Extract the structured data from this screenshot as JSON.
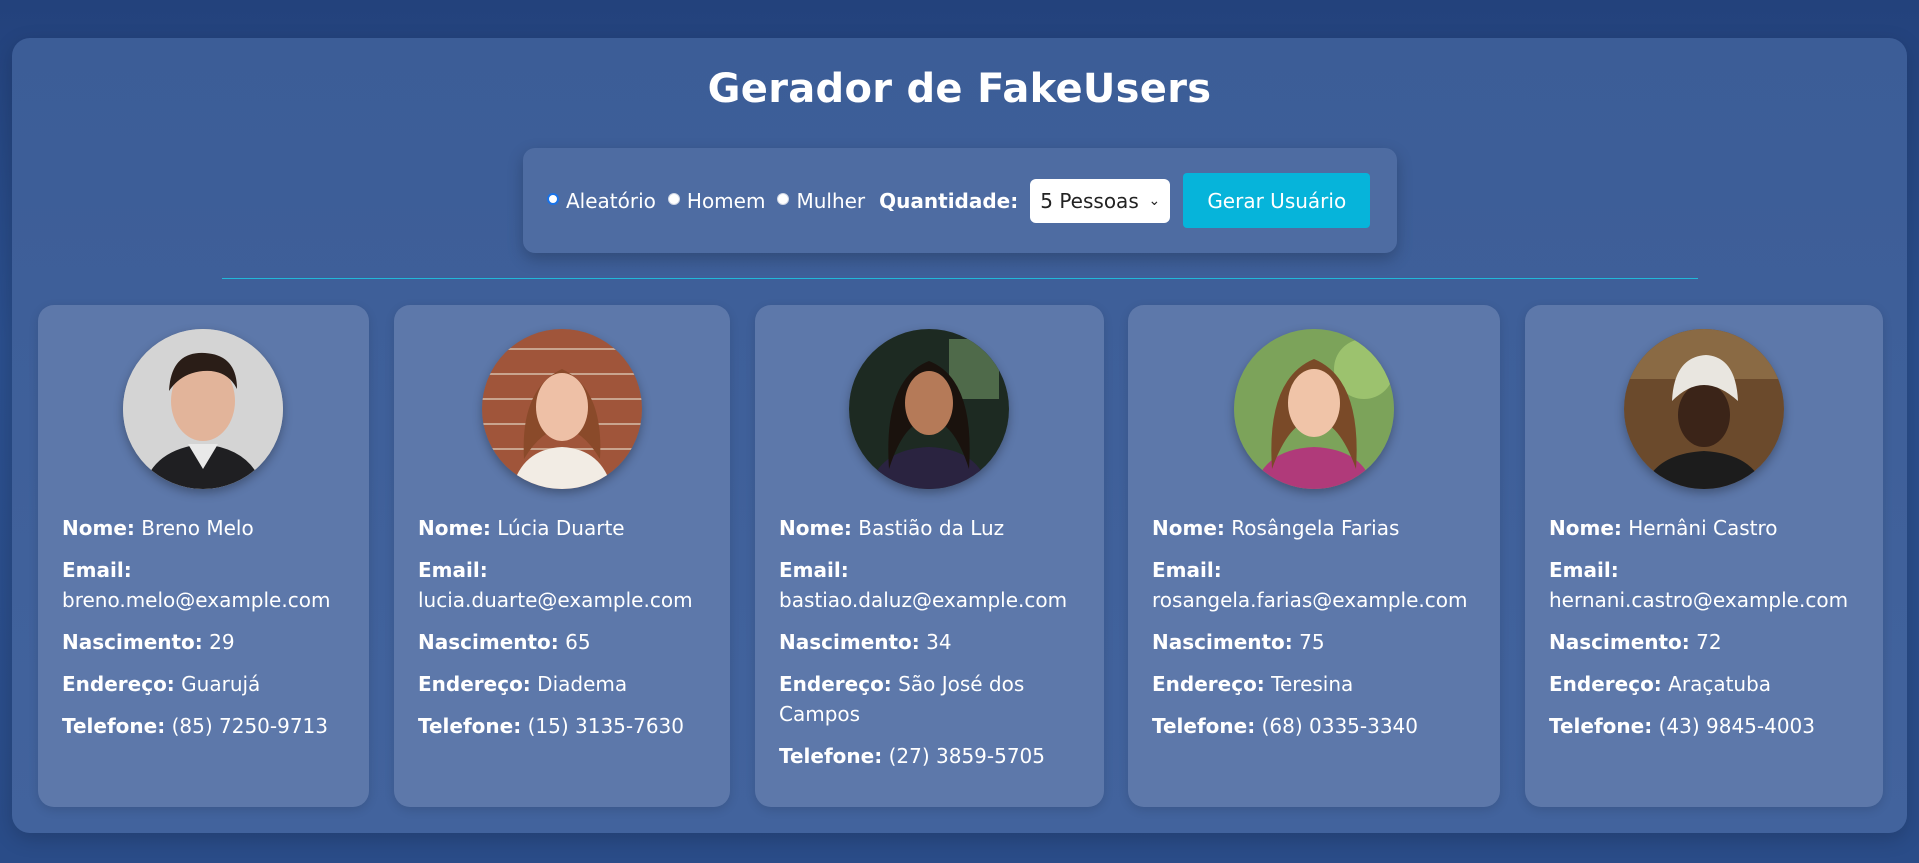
{
  "title": "Gerador de FakeUsers",
  "controls": {
    "options": [
      "Aleatório",
      "Homem",
      "Mulher"
    ],
    "selected_option": "Aleatório",
    "quantity_label": "Quantidade:",
    "quantity_value": "5 Pessoas",
    "button_label": "Gerar Usuário"
  },
  "field_labels": {
    "name": "Nome:",
    "email": "Email:",
    "birth": "Nascimento:",
    "address": "Endereço:",
    "phone": "Telefone:"
  },
  "users": [
    {
      "name": "Breno Melo",
      "email": "breno.melo@example.com",
      "birth": "29",
      "address": "Guarujá",
      "phone": "(85) 7250-9713"
    },
    {
      "name": "Lúcia Duarte",
      "email": "lucia.duarte@example.com",
      "birth": "65",
      "address": "Diadema",
      "phone": "(15) 3135-7630"
    },
    {
      "name": "Bastião da Luz",
      "email": "bastiao.daluz@example.com",
      "birth": "34",
      "address": "São José dos Campos",
      "phone": "(27) 3859-5705"
    },
    {
      "name": "Rosângela Farias",
      "email": "rosangela.farias@example.com",
      "birth": "75",
      "address": "Teresina",
      "phone": "(68) 0335-3340"
    },
    {
      "name": "Hernâni Castro",
      "email": "hernani.castro@example.com",
      "birth": "72",
      "address": "Araçatuba",
      "phone": "(43) 9845-4003"
    }
  ],
  "colors": {
    "background": "#2b4f8d",
    "panel": "#3c5d97",
    "card": "#5d78aa",
    "accent": "#06b4da"
  }
}
